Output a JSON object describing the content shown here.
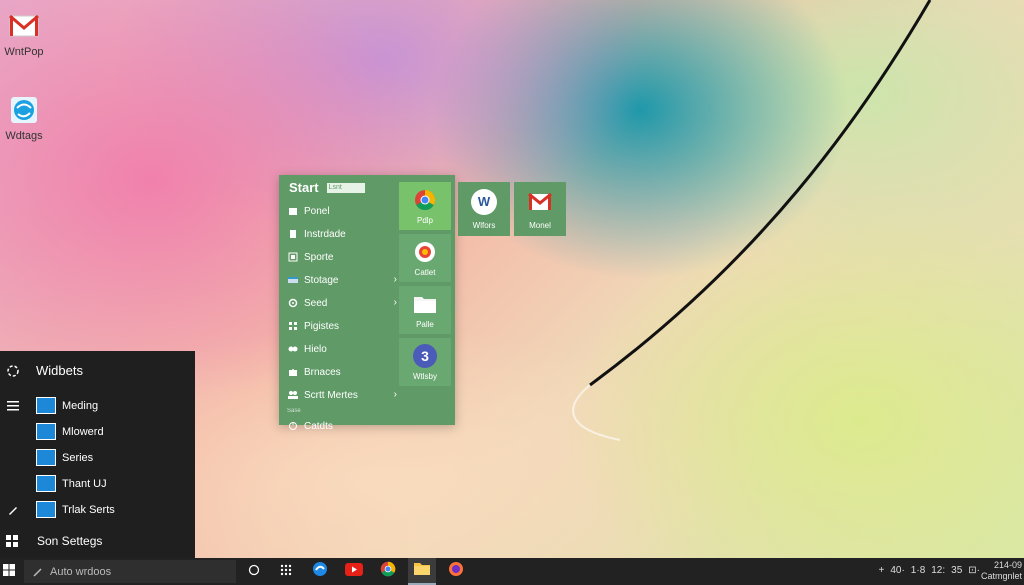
{
  "desktop": {
    "icons": [
      {
        "label": "WntPop",
        "icon": "gmail-icon"
      },
      {
        "label": "Wdtags",
        "icon": "globe-icon"
      }
    ]
  },
  "start_menu": {
    "title": "Start",
    "search_placeholder": "Lsnt",
    "items": [
      {
        "label": "Ponel",
        "icon": "panel-icon",
        "arrow": false
      },
      {
        "label": "Instrdade",
        "icon": "document-icon",
        "arrow": false
      },
      {
        "label": "Sporte",
        "icon": "book-icon",
        "arrow": false
      },
      {
        "label": "Stotage",
        "icon": "storage-icon",
        "arrow": true
      },
      {
        "label": "Seed",
        "icon": "gear-icon",
        "arrow": true
      },
      {
        "label": "Pigistes",
        "icon": "apps-icon",
        "arrow": false
      },
      {
        "label": "Hielo",
        "icon": "help-icon",
        "arrow": false
      },
      {
        "label": "Brnaces",
        "icon": "puzzle-icon",
        "arrow": false
      },
      {
        "label": "Scrtt Mertes",
        "icon": "people-icon",
        "arrow": true
      }
    ],
    "section_label": "Sase",
    "footer_item": "Catdts",
    "tiles": [
      {
        "label": "Pdlp",
        "icon": "chrome-icon"
      },
      {
        "label": "Catlet",
        "icon": "photos-icon"
      },
      {
        "label": "Palle",
        "icon": "folder-icon"
      },
      {
        "label": "Wtlsby",
        "icon": "number-3-icon",
        "number": "3"
      }
    ],
    "external_tiles": [
      {
        "label": "Wlfors",
        "icon": "word-icon",
        "letter": "W"
      },
      {
        "label": "Monel",
        "icon": "gmail-icon"
      }
    ]
  },
  "widgets": {
    "title": "Widbets",
    "items": [
      "Meding",
      "Mlowerd",
      "Series",
      "Thant UJ",
      "Trlak Serts"
    ],
    "footer": "Son Settegs"
  },
  "taskbar": {
    "search_text": "Auto wrdoos",
    "tray_text": [
      "+",
      "40·",
      "1·8",
      "12:",
      "35",
      "⊡·"
    ],
    "clock_time": "214-09",
    "clock_sub": "Catmgnlet"
  },
  "colors": {
    "menu_bg": "#5f9a67",
    "tile_active": "#78c26c",
    "widgets_bg": "#1f1f1f",
    "taskbar_bg": "#222222"
  }
}
